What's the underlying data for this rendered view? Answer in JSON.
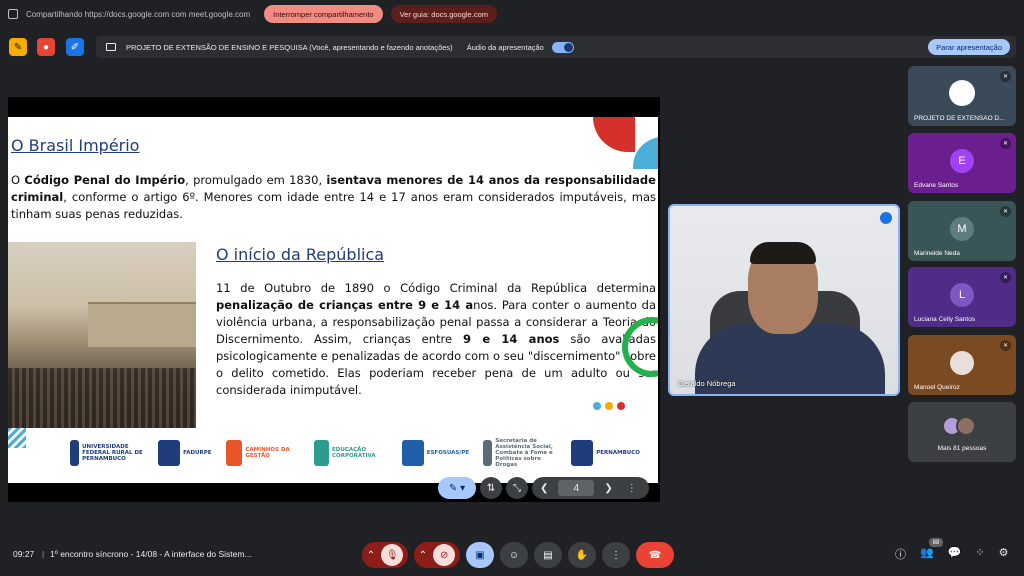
{
  "topbar": {
    "share_text": "Compartilhando https://docs.google.com com meet.google.com",
    "stop_sharing": "Interromper compartilhamento",
    "view_tab": "Ver guia: docs.google.com"
  },
  "presentation_bar": {
    "title": "PROJETO DE EXTENSÃO DE ENSINO E PESQUISA (Você, apresentando e fazendo anotações)",
    "audio_label": "Áudio da apresentação",
    "stop_button": "Parar apresentação"
  },
  "slide": {
    "heading1": "O Brasil Império",
    "para1_parts": [
      "O ",
      "Código Penal do Império",
      ", promulgado em 1830, ",
      "isentava menores de 14 anos da responsabilidade criminal",
      ", conforme o artigo 6º. Menores com idade entre 14 e 17 anos eram considerados imputáveis, mas tinham suas penas reduzidas."
    ],
    "heading2": "O início da República",
    "para2_parts": [
      "11 de Outubro de 1890 o Código Criminal da República determina ",
      "penalização de crianças entre 9 e 14 a",
      "nos. Para conter o aumento da violência urbana, a responsabilização penal passa a considerar a Teoria do Discernimento. Assim, crianças entre ",
      "9 e 14 anos",
      " são avaliadas psicologicamente e penalizadas de acordo com o seu \"discernimento\" sobre o delito cometido. Elas poderiam receber pena de um adulto ou ser considerada inimputável."
    ],
    "logos": [
      {
        "name": "UNIVERSIDADE FEDERAL RURAL DE PERNAMBUCO",
        "color": "#1f3d7a"
      },
      {
        "name": "FADURPE",
        "color": "#1f3d7a"
      },
      {
        "name": "CAMINHOS DA GESTÃO",
        "color": "#e8562a"
      },
      {
        "name": "EDUCAÇÃO CORPORATIVA",
        "color": "#2a9d8f"
      },
      {
        "name": "ESFOSUAS/PE",
        "color": "#1f5fa8"
      },
      {
        "name": "Secretaria de Assistência Social, Combate à Fome e Políticas sobre Drogas",
        "color": "#5a6b7a"
      },
      {
        "name": "PERNAMBUCO",
        "color": "#1f3d7a"
      }
    ],
    "dot_colors": [
      "#4aaed9",
      "#f9ab00",
      "#d6302a"
    ]
  },
  "slide_controls": {
    "page": "4"
  },
  "video": {
    "speaker_name": "Geraldo Nóbrega"
  },
  "participants": [
    {
      "name": "PROJETO DE EXTENSÃO D...",
      "initial": ""
    },
    {
      "name": "Edvane Santos",
      "initial": "E"
    },
    {
      "name": "Marineide Neda",
      "initial": "M"
    },
    {
      "name": "Luciana Celly Santos",
      "initial": "L"
    },
    {
      "name": "Manoel Queiroz",
      "initial": ""
    },
    {
      "name": "Mais 81 pessoas",
      "initial": ""
    }
  ],
  "bottom": {
    "time": "09:27",
    "separator": "|",
    "meeting_title": "1º encontro síncrono - 14/08 - A interface do Sistem...",
    "participant_count": "88"
  },
  "colors": {
    "accent": "#8ab4f8",
    "hangup": "#ea4335",
    "stop_share": "#f28b82"
  }
}
